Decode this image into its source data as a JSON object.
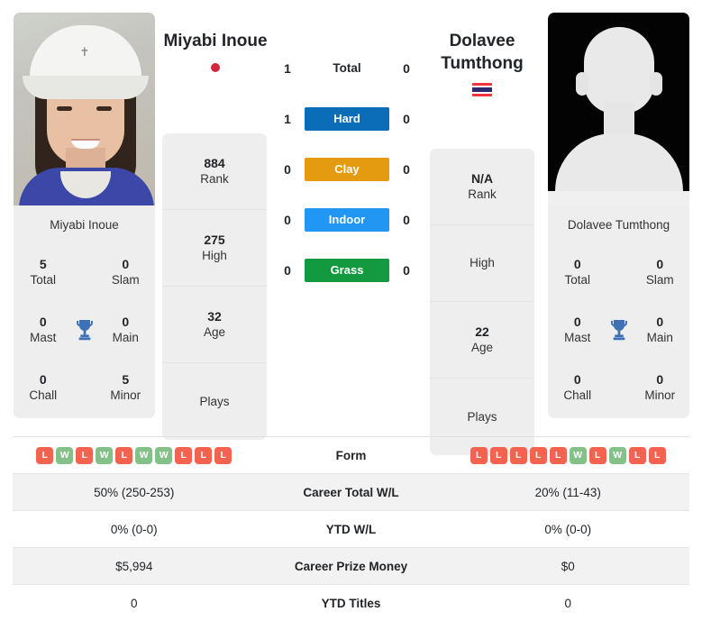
{
  "players": {
    "left": {
      "name": "Miyabi Inoue",
      "flag": "japan-flag",
      "photo_caption": "Miyabi Inoue",
      "rank": "884",
      "rank_label": "Rank",
      "high": "275",
      "high_label": "High",
      "age": "32",
      "age_label": "Age",
      "plays": "",
      "plays_label": "Plays",
      "titles": {
        "total": "5",
        "total_label": "Total",
        "slam": "0",
        "slam_label": "Slam",
        "mast": "0",
        "mast_label": "Mast",
        "main": "0",
        "main_label": "Main",
        "chall": "0",
        "chall_label": "Chall",
        "minor": "5",
        "minor_label": "Minor"
      },
      "form": [
        "L",
        "W",
        "L",
        "W",
        "L",
        "W",
        "W",
        "L",
        "L",
        "L"
      ],
      "career_total_wl": "50% (250-253)",
      "ytd_wl": "0% (0-0)",
      "career_prize_money": "$5,994",
      "ytd_titles": "0"
    },
    "right": {
      "name": "Dolavee Tumthong",
      "flag": "thailand-flag",
      "photo_caption": "Dolavee Tumthong",
      "rank": "N/A",
      "rank_label": "Rank",
      "high": "",
      "high_label": "High",
      "age": "22",
      "age_label": "Age",
      "plays": "",
      "plays_label": "Plays",
      "titles": {
        "total": "0",
        "total_label": "Total",
        "slam": "0",
        "slam_label": "Slam",
        "mast": "0",
        "mast_label": "Mast",
        "main": "0",
        "main_label": "Main",
        "chall": "0",
        "chall_label": "Chall",
        "minor": "0",
        "minor_label": "Minor"
      },
      "form": [
        "L",
        "L",
        "L",
        "L",
        "L",
        "W",
        "L",
        "W",
        "L",
        "L"
      ],
      "career_total_wl": "20% (11-43)",
      "ytd_wl": "0% (0-0)",
      "career_prize_money": "$0",
      "ytd_titles": "0"
    }
  },
  "head_to_head": {
    "rows": [
      {
        "label": "Total",
        "left": "1",
        "right": "0",
        "color": "",
        "plain": true
      },
      {
        "label": "Hard",
        "left": "1",
        "right": "0",
        "color": "#0B6CB8",
        "plain": false
      },
      {
        "label": "Clay",
        "left": "0",
        "right": "0",
        "color": "#E49B0F",
        "plain": false
      },
      {
        "label": "Indoor",
        "left": "0",
        "right": "0",
        "color": "#2196F3",
        "plain": false
      },
      {
        "label": "Grass",
        "left": "0",
        "right": "0",
        "color": "#149A3E",
        "plain": false
      }
    ]
  },
  "comparison_table": {
    "rows": [
      {
        "key": "form",
        "label": "Form"
      },
      {
        "key": "wl",
        "label": "Career Total W/L"
      },
      {
        "key": "ytdwl",
        "label": "YTD W/L"
      },
      {
        "key": "prize",
        "label": "Career Prize Money"
      },
      {
        "key": "titles",
        "label": "YTD Titles"
      }
    ]
  },
  "colors": {
    "hard": "#0B6CB8",
    "clay": "#E49B0F",
    "indoor": "#2196F3",
    "grass": "#149A3E",
    "win": "#84c189",
    "loss": "#f4634f",
    "trophy": "#3f72b4"
  }
}
